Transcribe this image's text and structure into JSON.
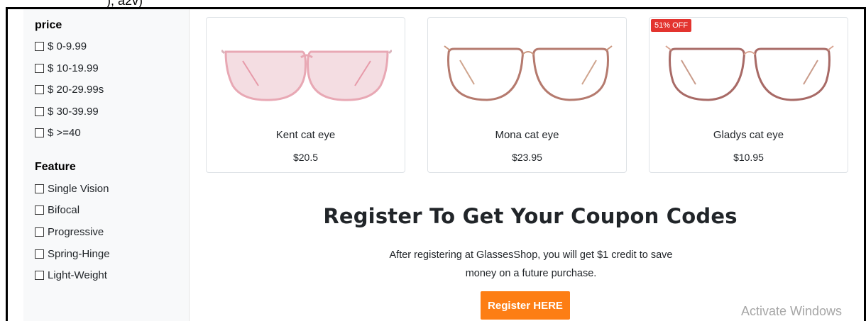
{
  "page_fragment": "), a2v)",
  "sidebar": {
    "groups": [
      {
        "title": "price",
        "options": [
          "$ 0-9.99",
          "$ 10-19.99",
          "$ 20-29.99s",
          "$ 30-39.99",
          "$ >=40"
        ]
      },
      {
        "title": "Feature",
        "options": [
          "Single Vision",
          "Bifocal",
          "Progressive",
          "Spring-Hinge",
          "Light-Weight"
        ]
      }
    ]
  },
  "products": [
    {
      "name": "Kent cat eye",
      "price": "$20.5",
      "badge": "",
      "frame_color": "#e8a8b4",
      "lens_color": "#f4dde2",
      "style": "cat-eye-square"
    },
    {
      "name": "Mona cat eye",
      "price": "$23.95",
      "badge": "",
      "frame_color": "#b57a6e",
      "lens_color": "#ffffff",
      "style": "metal-square"
    },
    {
      "name": "Gladys cat eye",
      "price": "$10.95",
      "badge": "51% OFF",
      "frame_color": "#a86a66",
      "lens_color": "#ffffff",
      "style": "metal-square"
    }
  ],
  "register": {
    "title": "Register To Get Your Coupon Codes",
    "text_line1": "After registering at GlassesShop, you will get $1 credit to save",
    "text_line2": "money on a future purchase.",
    "button_label": "Register HERE",
    "button_color": "#fd7e14"
  },
  "watermark": "Activate Windows"
}
